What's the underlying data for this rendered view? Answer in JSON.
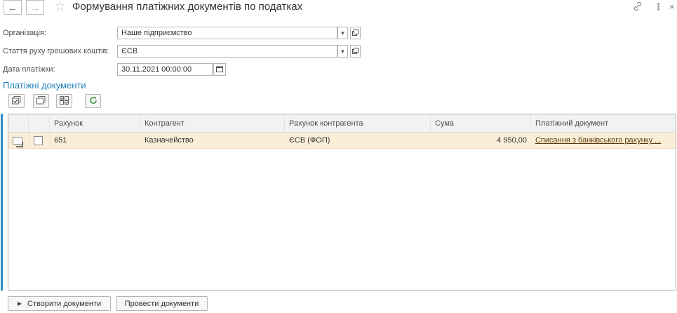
{
  "window": {
    "title": "Формування платіжних документів по податках"
  },
  "form": {
    "organization": {
      "label": "Організація:",
      "value": "Наше підприємство"
    },
    "cashflow_item": {
      "label": "Стаття руху грошових коштів:",
      "value": "ЄСВ"
    },
    "payment_date": {
      "label": "Дата платіжки:",
      "value": "30.11.2021 00:00:00"
    }
  },
  "section": {
    "title": "Платіжні документи"
  },
  "table": {
    "columns": [
      "Рахунок",
      "Контрагент",
      "Рахунок контрагента",
      "Сума",
      "Платіжний документ"
    ],
    "rows": [
      {
        "account": "651",
        "counterparty": "Казначейство",
        "counterparty_account": "ЄСВ (ФОП)",
        "sum": "4 950,00",
        "payment_document": "Списання з банківського рахунку ..."
      }
    ]
  },
  "actions": {
    "create": "Створити документи",
    "post": "Провести документи"
  },
  "icons": {
    "back": "arrow-left-icon",
    "forward": "arrow-right-icon",
    "favorite": "star-icon",
    "link": "link-icon",
    "more": "more-vertical-icon",
    "close": "close-icon",
    "refresh": "refresh-icon"
  },
  "colors": {
    "accent": "#1c7fbd",
    "selected_row": "#fbeed9",
    "refresh_icon": "#3a9a3a"
  }
}
